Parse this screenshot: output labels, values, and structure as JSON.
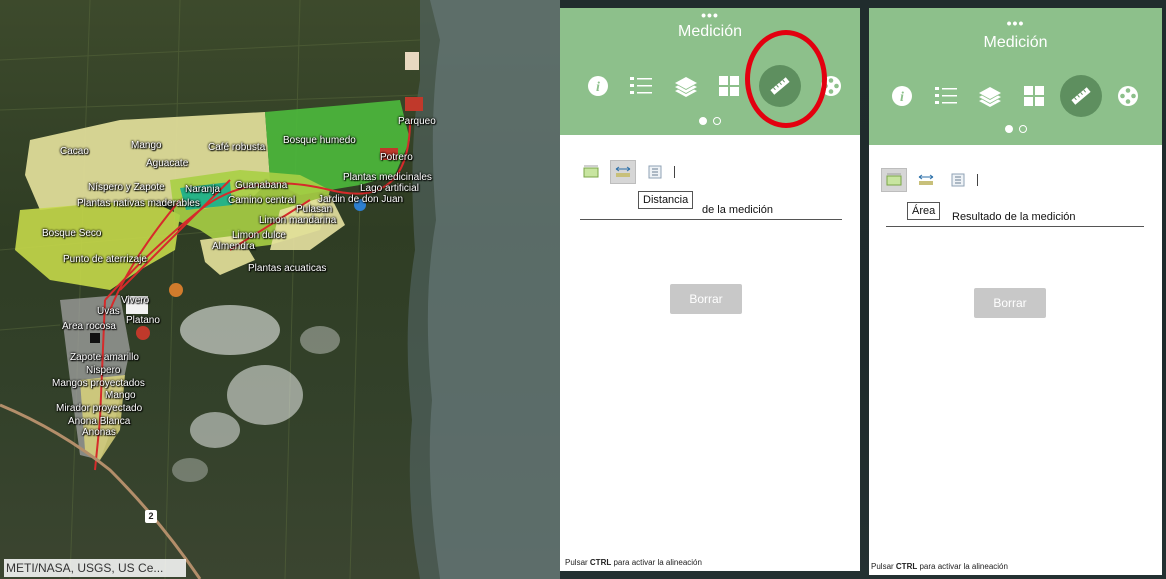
{
  "map": {
    "attribution": "METI/NASA, USGS, US Ce...",
    "route_badge": "2",
    "labels": {
      "parqueo": "Parqueo",
      "potrero": "Potrero",
      "bosque_humedo": "Bosque humedo",
      "mango1": "Mango",
      "cafe_robusta": "Café robusta",
      "cacao": "Cacao",
      "aguacate": "Aguacate",
      "nispero_zapote": "Níspero y Zapote",
      "naranja": "Naranja",
      "guanabana": "Guanabana",
      "plantas_medicinales": "Plantas medicinales",
      "lago_artificial": "Lago artificial",
      "plantas_nativas": "Plantas nativas maderables",
      "camino_central": "Camino central",
      "jardin": "Jardin de don Juan",
      "pulasan": "Pulasan",
      "limon_mandarina": "Limon mandarina",
      "bosque_seco": "Bosque Seco",
      "limon_dulce": "Limon dulce",
      "almendra": "Almendra",
      "punto_aterrizaje": "Punto de aterrizaje",
      "plantas_acuaticas": "Plantas acuaticas",
      "vivero": "Vivero",
      "uvas": "Uvas",
      "platano": "Platano",
      "area_rocosa": "Area rocosa",
      "zapote_amarillo": "Zapote amarillo",
      "nispero2": "Nispero",
      "mangos_proyectados": "Mangos proyectados",
      "mango2": "Mango",
      "mirador": "Mirador proyectado",
      "anona_blanca": "Anona Blanca",
      "anonas": "Anonas"
    }
  },
  "panel_left": {
    "dots": "•••",
    "title": "Medición",
    "icons": [
      "info-icon",
      "legend-icon",
      "layers-icon",
      "basemap-icon",
      "ruler-icon",
      "filmstrip-icon"
    ],
    "active_icon": "ruler-icon",
    "tooltip": "Distancia",
    "result_label": "de la medición",
    "clear_button": "Borrar",
    "hint_prefix": "Pulsar ",
    "hint_key": "CTRL",
    "hint_suffix": " para activar la alineación"
  },
  "panel_right": {
    "dots": "•••",
    "title": "Medición",
    "icons": [
      "info-icon",
      "legend-icon",
      "layers-icon",
      "basemap-icon",
      "ruler-icon",
      "filmstrip-icon"
    ],
    "active_icon": "ruler-icon",
    "tooltip": "Área",
    "result_label": "Resultado de la medición",
    "clear_button": "Borrar",
    "hint_prefix": "Pulsar ",
    "hint_key": "CTRL",
    "hint_suffix": " para activar la alineación"
  },
  "colors": {
    "header_green": "#8dc08b",
    "active_icon_bg": "#5e8f5f",
    "highlight_ring": "#e3000f",
    "disabled_button": "#c8c8c8"
  }
}
